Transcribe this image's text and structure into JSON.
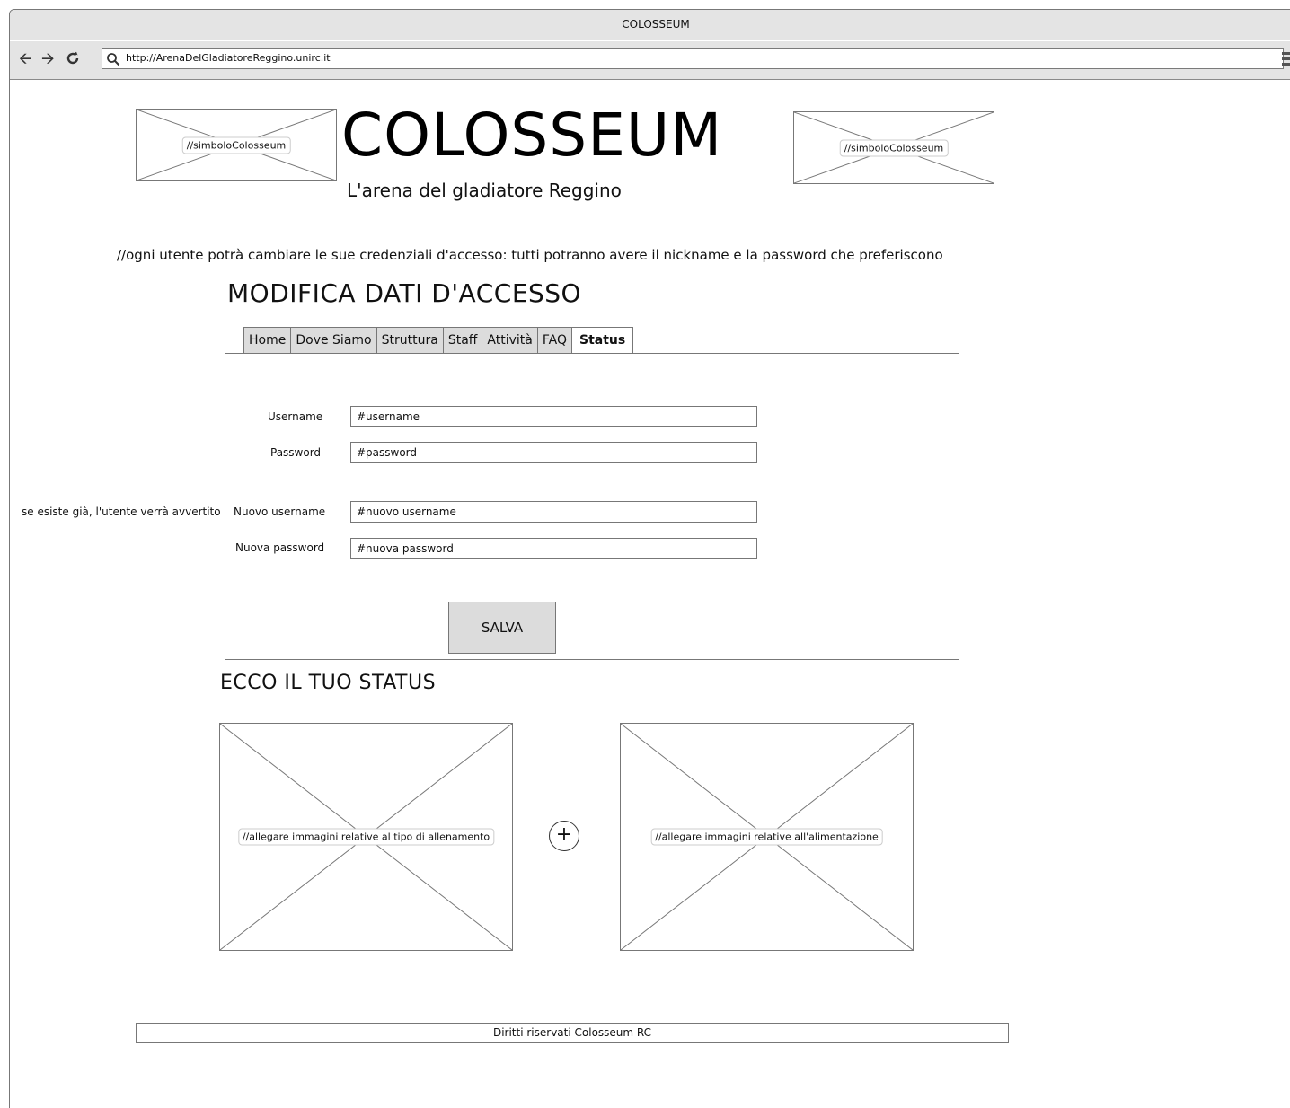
{
  "window": {
    "title": "COLOSSEUM",
    "url": "http://ArenaDelGladiatoreReggino.unirc.it",
    "back_icon": "arrow-left-icon",
    "forward_icon": "arrow-right-icon",
    "reload_icon": "reload-icon",
    "search_icon": "search-icon",
    "menu_icon": "hamburger-menu-icon"
  },
  "header": {
    "logo_left_label": "//simboloColosseum",
    "logo_right_label": "//simboloColosseum",
    "title": "COLOSSEUM",
    "subtitle": "L'arena del gladiatore Reggino"
  },
  "note": "//ogni utente potrà cambiare le sue credenziali d'accesso: tutti potranno avere il nickname e la password che preferiscono",
  "section_title": "MODIFICA DATI D'ACCESSO",
  "tabs": [
    {
      "label": "Home"
    },
    {
      "label": "Dove Siamo"
    },
    {
      "label": "Struttura"
    },
    {
      "label": "Staff"
    },
    {
      "label": "Attività"
    },
    {
      "label": "FAQ"
    },
    {
      "label": "Status",
      "active": true
    }
  ],
  "form": {
    "username_label": "Username",
    "username_value": "#username",
    "password_label": "Password",
    "password_value": "#password",
    "new_username_label": "Nuovo username",
    "new_username_value": "#nuovo username",
    "new_password_label": "Nuova password",
    "new_password_value": "#nuova password",
    "save_label": "SALVA"
  },
  "side_note": "se esiste già, l'utente verrà avvertito",
  "status": {
    "title": "ECCO IL TUO STATUS",
    "training_image_label": "//allegare immagini relative al tipo di allenamento",
    "nutrition_image_label": "//allegare immagini relative all'alimentazione",
    "add_label": "+"
  },
  "footer": "Diritti riservati Colosseum RC"
}
